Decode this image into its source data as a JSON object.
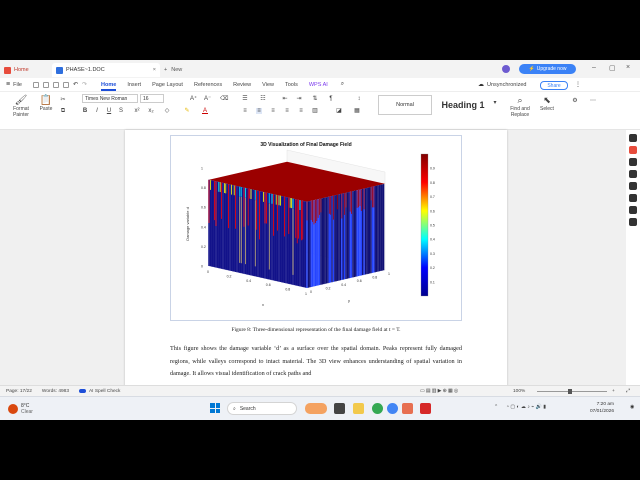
{
  "tabs": {
    "home": "Home",
    "doc": "PHASE~1.DOC",
    "new": "New"
  },
  "top_right": {
    "upgrade": "Upgrade now"
  },
  "menu": {
    "file": "File",
    "items": [
      "Home",
      "Insert",
      "Page Layout",
      "References",
      "Review",
      "View",
      "Tools",
      "WPS AI"
    ],
    "unsync": "Unsynchronized",
    "share": "Share"
  },
  "ribbon": {
    "format_painter": "Format Painter",
    "paste": "Paste",
    "font": "Times New Roman",
    "size": "16",
    "style_normal": "Normal",
    "style_heading": "Heading 1",
    "find_replace": "Find and Replace",
    "select": "Select"
  },
  "document": {
    "caption": "Figure 8: Three-dimensional representation of the final damage field at t = T.",
    "paragraph": "This figure shows the damage variable ‘d’ as a surface over the spatial domain. Peaks represent fully damaged regions, while valleys correspond to intact material. The 3D view enhances understanding of spatial variation in damage. It allows visual identification of crack paths and"
  },
  "chart_data": {
    "type": "surface3d",
    "title": "3D Visualization of Final Damage Field",
    "xlabel": "x",
    "ylabel": "y",
    "zlabel": "Damage variable d",
    "x_ticks": [
      "0",
      "0.2",
      "0.4",
      "0.6",
      "0.8",
      "1"
    ],
    "y_ticks": [
      "0",
      "0.2",
      "0.4",
      "0.6",
      "0.8",
      "1"
    ],
    "z_ticks": [
      "0",
      "0.2",
      "0.4",
      "0.6",
      "0.8",
      "1"
    ],
    "zlim": [
      0,
      1
    ],
    "colorbar_ticks": [
      "0.1",
      "0.2",
      "0.3",
      "0.4",
      "0.5",
      "0.6",
      "0.7",
      "0.8",
      "0.9"
    ],
    "colormap": [
      "#00008f",
      "#0000ff",
      "#00ffff",
      "#ffff00",
      "#ff0000",
      "#800000"
    ]
  },
  "status": {
    "page": "Page: 17/22",
    "words": "Words: 4983",
    "spell": "AI Spell Check",
    "zoom": "100%"
  },
  "taskbar": {
    "weather_temp": "8°C",
    "weather_desc": "Clear",
    "search": "Search",
    "time": "7:20 am",
    "date": "07/01/2026"
  }
}
